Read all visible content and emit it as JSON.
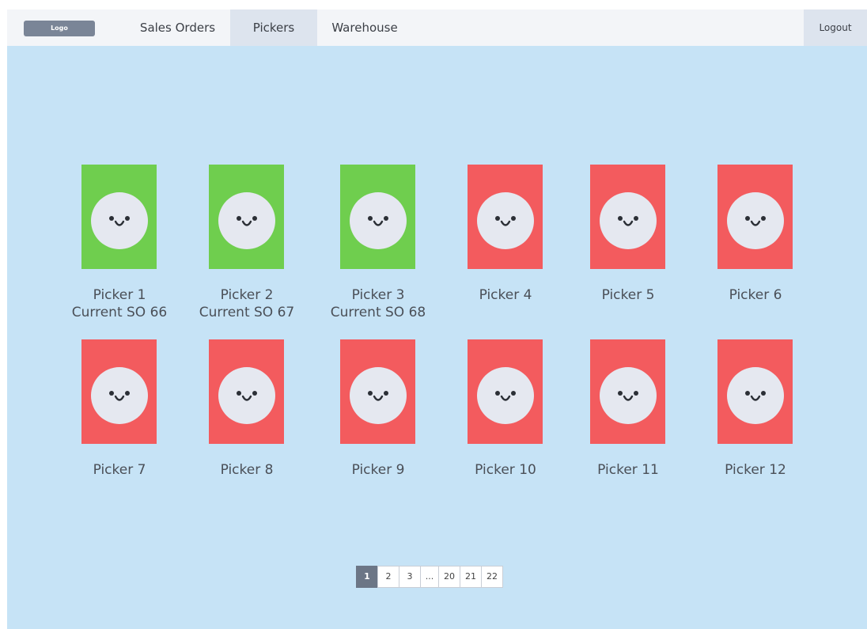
{
  "header": {
    "logo": "Logo",
    "tabs": [
      {
        "label": "Sales Orders"
      },
      {
        "label": "Pickers"
      },
      {
        "label": "Warehouse"
      }
    ],
    "logout": "Logout"
  },
  "pickers": [
    {
      "name": "Picker 1",
      "current": "Current SO 66",
      "status": "active",
      "color": "#6fce4e"
    },
    {
      "name": "Picker 2",
      "current": "Current SO 67",
      "status": "active",
      "color": "#6fce4e"
    },
    {
      "name": "Picker 3",
      "current": "Current SO 68",
      "status": "active",
      "color": "#6fce4e"
    },
    {
      "name": "Picker 4",
      "current": "",
      "status": "idle",
      "color": "#f35b5e"
    },
    {
      "name": "Picker 5",
      "current": "",
      "status": "idle",
      "color": "#f35b5e"
    },
    {
      "name": "Picker 6",
      "current": "",
      "status": "idle",
      "color": "#f35b5e"
    },
    {
      "name": "Picker 7",
      "current": "",
      "status": "idle",
      "color": "#f35b5e"
    },
    {
      "name": "Picker 8",
      "current": "",
      "status": "idle",
      "color": "#f35b5e"
    },
    {
      "name": "Picker 9",
      "current": "",
      "status": "idle",
      "color": "#f35b5e"
    },
    {
      "name": "Picker 10",
      "current": "",
      "status": "idle",
      "color": "#f35b5e"
    },
    {
      "name": "Picker 11",
      "current": "",
      "status": "idle",
      "color": "#f35b5e"
    },
    {
      "name": "Picker 12",
      "current": "",
      "status": "idle",
      "color": "#f35b5e"
    }
  ],
  "pagination": {
    "pages": [
      "1",
      "2",
      "3",
      "...",
      "20",
      "21",
      "22"
    ],
    "current": "1"
  },
  "colors": {
    "background": "#c6e3f6",
    "active": "#6fce4e",
    "idle": "#f35b5e"
  },
  "icons": {
    "picker_avatar": "smiley-face-icon"
  }
}
